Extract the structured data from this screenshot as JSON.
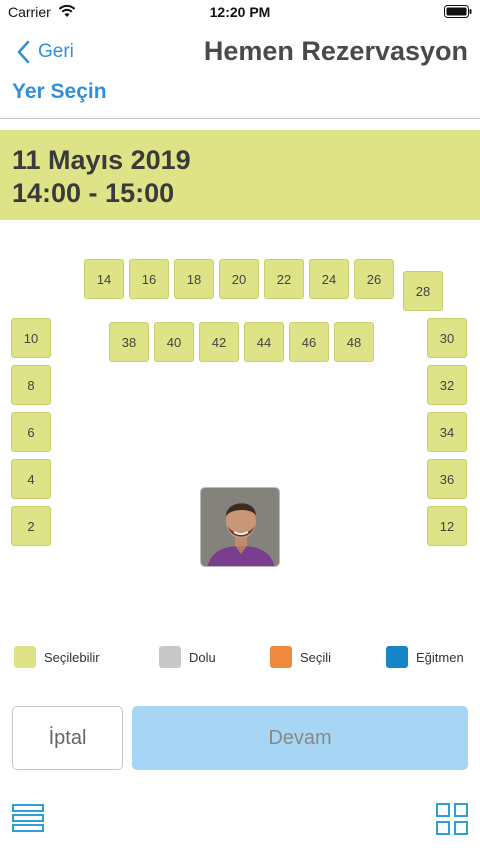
{
  "status_bar": {
    "carrier": "Carrier",
    "time": "12:20 PM"
  },
  "nav": {
    "back_label": "Geri",
    "title": "Hemen Rezervasyon"
  },
  "section_title": "Yer Seçin",
  "session": {
    "date": "11 Mayıs 2019",
    "time": "14:00 - 15:00"
  },
  "seats": {
    "top_row": [
      "14",
      "16",
      "18",
      "20",
      "22",
      "24",
      "26"
    ],
    "corner": "28",
    "second_row": [
      "38",
      "40",
      "42",
      "44",
      "46",
      "48"
    ],
    "left_column": [
      "10",
      "8",
      "6",
      "4",
      "2"
    ],
    "right_column": [
      "30",
      "32",
      "34",
      "36",
      "12"
    ]
  },
  "legend": {
    "available": "Seçilebilir",
    "occupied": "Dolu",
    "selected": "Seçili",
    "instructor": "Eğitmen"
  },
  "colors": {
    "available": "#dde386",
    "occupied": "#c8c8c8",
    "selected": "#f08a3c",
    "instructor": "#1485c8",
    "accent": "#2f8fd8"
  },
  "actions": {
    "cancel_label": "İptal",
    "continue_label": "Devam"
  },
  "icons": {
    "back": "chevron-left-icon",
    "list": "list-icon",
    "grid": "grid-icon",
    "wifi": "wifi-icon",
    "battery": "battery-icon"
  }
}
